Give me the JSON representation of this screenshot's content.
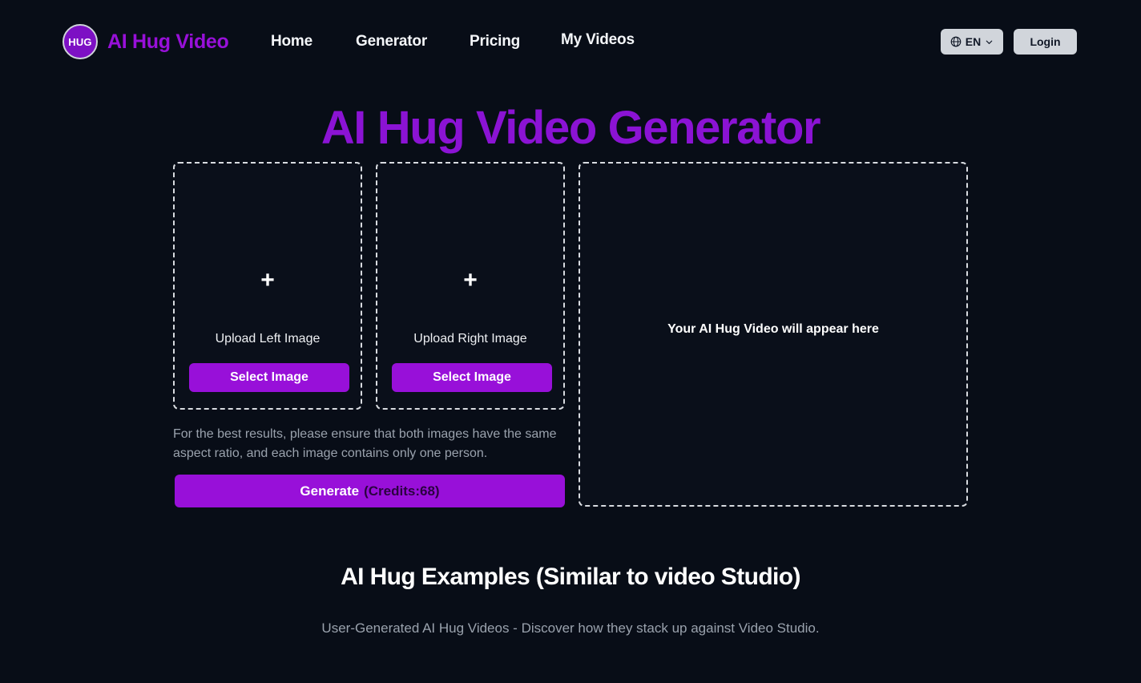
{
  "header": {
    "logo_text": "HUG",
    "brand_name": "AI Hug Video",
    "nav": [
      {
        "label": "Home"
      },
      {
        "label": "Generator"
      },
      {
        "label": "Pricing"
      },
      {
        "label": "My Videos"
      }
    ],
    "language": {
      "icon": "globe-icon",
      "value": "EN",
      "chevron": "chevron-down-icon"
    },
    "login_label": "Login"
  },
  "hero": {
    "title": "AI Hug Video Generator"
  },
  "uploads": [
    {
      "plus_icon": "plus-icon",
      "label": "Upload Left Image",
      "button_label": "Select Image"
    },
    {
      "plus_icon": "plus-icon",
      "label": "Upload Right Image",
      "button_label": "Select Image"
    }
  ],
  "helper_text": "For the best results, please ensure that both images have the same aspect ratio, and each image contains only one person.",
  "generate": {
    "label": "Generate",
    "credits_label": "(Credits:68)",
    "credits": 68
  },
  "preview": {
    "placeholder": "Your AI Hug Video will appear here"
  },
  "examples": {
    "heading": "AI Hug Examples (Similar to video Studio)",
    "subtitle": "User-Generated AI Hug Videos - Discover how they stack up against Video Studio."
  },
  "colors": {
    "background": "#080d17",
    "accent_purple": "#9810d9",
    "title_purple": "#8b13d4",
    "button_light": "#d1d5db",
    "muted_text": "#9aa2ad",
    "dashed_border": "#d8dbe0"
  }
}
